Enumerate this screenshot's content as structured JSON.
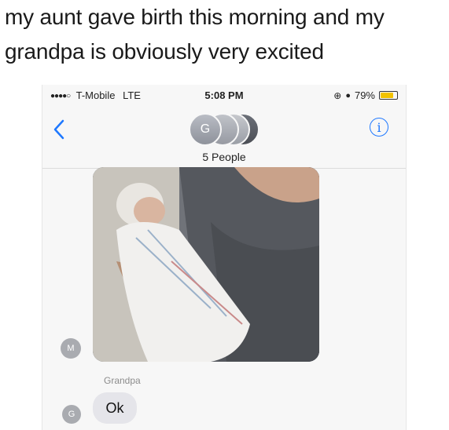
{
  "caption": {
    "line1": "my aunt gave birth this morning and my",
    "line2": "grandpa is obviously very excited"
  },
  "status_bar": {
    "signal_dots": "●●●●○",
    "carrier": "T-Mobile",
    "network": "LTE",
    "time": "5:08 PM",
    "battery_percent": "79%",
    "battery_level": 0.79,
    "battery_color": "#f2c200"
  },
  "header": {
    "back_icon": "chevron-left-icon",
    "group_avatar_initial": "G",
    "people_count": "5 People",
    "info_icon": "info-icon",
    "info_symbol": "i",
    "accent_color": "#1e78ff"
  },
  "messages": {
    "photo_message": {
      "sender_initial": "M",
      "content": "baby-photo"
    },
    "text_message": {
      "sender_name": "Grandpa",
      "sender_initial": "G",
      "text": "Ok"
    }
  }
}
